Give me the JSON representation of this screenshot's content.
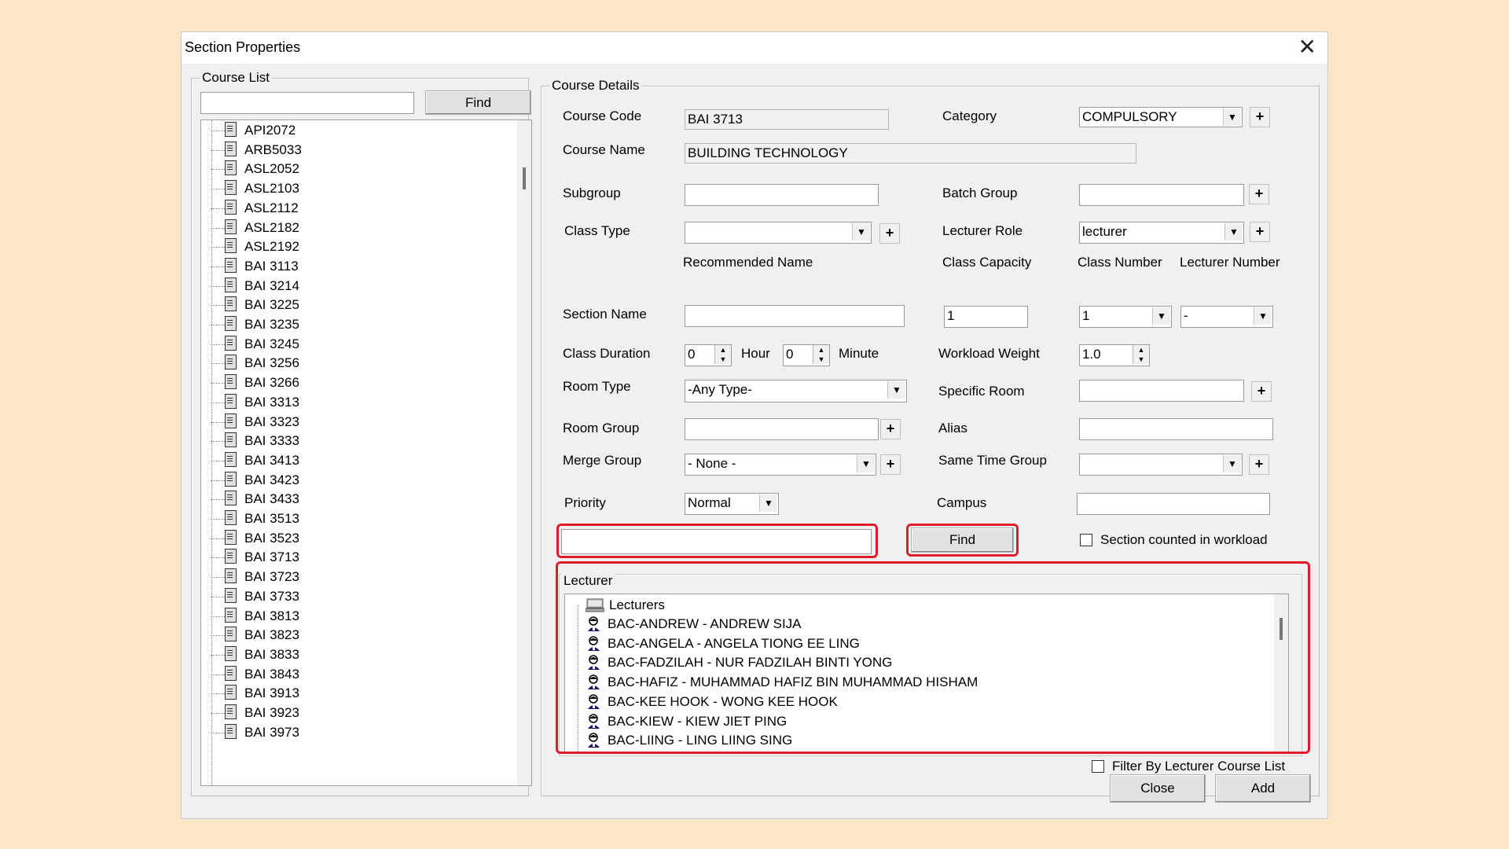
{
  "window": {
    "title": "Section Properties",
    "close_glyph": "✕"
  },
  "course_list": {
    "legend": "Course List",
    "search_value": "",
    "find_label": "Find",
    "items": [
      "API2072",
      "ARB5033",
      "ASL2052",
      "ASL2103",
      "ASL2112",
      "ASL2182",
      "ASL2192",
      "BAI 3113",
      "BAI 3214",
      "BAI 3225",
      "BAI 3235",
      "BAI 3245",
      "BAI 3256",
      "BAI 3266",
      "BAI 3313",
      "BAI 3323",
      "BAI 3333",
      "BAI 3413",
      "BAI 3423",
      "BAI 3433",
      "BAI 3513",
      "BAI 3523",
      "BAI 3713",
      "BAI 3723",
      "BAI 3733",
      "BAI 3813",
      "BAI 3823",
      "BAI 3833",
      "BAI 3843",
      "BAI 3913",
      "BAI 3923",
      "BAI 3973"
    ]
  },
  "details": {
    "legend": "Course Details",
    "course_code_label": "Course Code",
    "course_code": "BAI 3713",
    "category_label": "Category",
    "category": "COMPULSORY",
    "course_name_label": "Course Name",
    "course_name": "BUILDING TECHNOLOGY",
    "subgroup_label": "Subgroup",
    "subgroup": "",
    "batch_group_label": "Batch Group",
    "batch_group": "",
    "class_type_label": "Class Type",
    "class_type": "",
    "lecturer_role_label": "Lecturer Role",
    "lecturer_role": "lecturer",
    "recommended_name_label": "Recommended Name",
    "class_capacity_label": "Class Capacity",
    "class_capacity": "1",
    "class_number_label": "Class Number",
    "class_number": "1",
    "lecturer_number_label": "Lecturer Number",
    "lecturer_number": "-",
    "section_name_label": "Section Name",
    "section_name": "",
    "class_duration_label": "Class Duration",
    "hour_value": "0",
    "hour_label": "Hour",
    "minute_value": "0",
    "minute_label": "Minute",
    "workload_weight_label": "Workload Weight",
    "workload_weight": "1.0",
    "room_type_label": "Room Type",
    "room_type": "-Any Type-",
    "specific_room_label": "Specific Room",
    "specific_room": "",
    "room_group_label": "Room Group",
    "room_group": "",
    "alias_label": "Alias",
    "alias": "",
    "merge_group_label": "Merge Group",
    "merge_group": "- None -",
    "same_time_group_label": "Same Time Group",
    "same_time_group": "",
    "priority_label": "Priority",
    "priority": "Normal",
    "campus_label": "Campus",
    "campus": "",
    "lecturer_search": "",
    "find_label": "Find",
    "section_counted_label": "Section counted in workload",
    "plus": "+"
  },
  "lecturer": {
    "legend": "Lecturer",
    "root": "Lecturers",
    "items": [
      "BAC-ANDREW - ANDREW SIJA",
      "BAC-ANGELA - ANGELA TIONG EE LING",
      "BAC-FADZILAH - NUR FADZILAH BINTI YONG",
      "BAC-HAFIZ - MUHAMMAD HAFIZ BIN MUHAMMAD HISHAM",
      "BAC-KEE HOOK - WONG KEE HOOK",
      "BAC-KIEW - KIEW JIET PING",
      "BAC-LIING - LING LIING SING"
    ],
    "filter_label": "Filter By Lecturer Course List"
  },
  "footer": {
    "close_label": "Close",
    "add_label": "Add"
  },
  "colors": {
    "highlight": "#e01b2d",
    "background": "#fde6c6"
  }
}
